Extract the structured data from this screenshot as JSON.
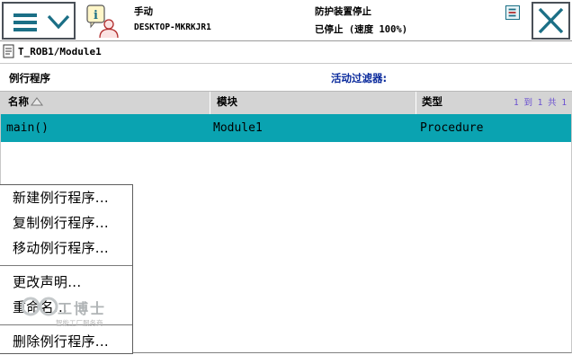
{
  "topbar": {
    "mode": "手动",
    "controller": "DESKTOP-MKRKJR1",
    "safety_state": "防护装置停止",
    "run_state": "已停止",
    "speed": "(速度 100%)"
  },
  "icons": {
    "menu": "hamburger-menu-icon",
    "menu_chevron": "chevron-down-icon",
    "info": "info-person-icon",
    "status_mini": "status-indicator-icon",
    "close": "close-icon",
    "breadcrumb": "program-module-icon",
    "sort": "sort-ascending-icon"
  },
  "colors": {
    "accent": "#1b6f86",
    "selected_row": "#0aa3b1",
    "header_bg": "#d4d4d4",
    "filter_text": "#0a2a9c",
    "pager_text": "#6a4fd0"
  },
  "breadcrumb": "T_ROB1/Module1",
  "section_title": "例行程序",
  "filter_label": "活动过滤器:",
  "table": {
    "columns": [
      "名称",
      "模块",
      "类型"
    ],
    "pager": "1 到 1 共 1",
    "rows": [
      {
        "name": "main()",
        "module": "Module1",
        "type": "Procedure",
        "selected": true
      }
    ]
  },
  "context_menu": {
    "items": [
      "新建例行程序...",
      "复制例行程序...",
      "移动例行程序...",
      "更改声明...",
      "重命名...",
      "删除例行程序..."
    ]
  },
  "watermark": {
    "title": "工博士",
    "subtitle": "智能工厂服务商"
  }
}
